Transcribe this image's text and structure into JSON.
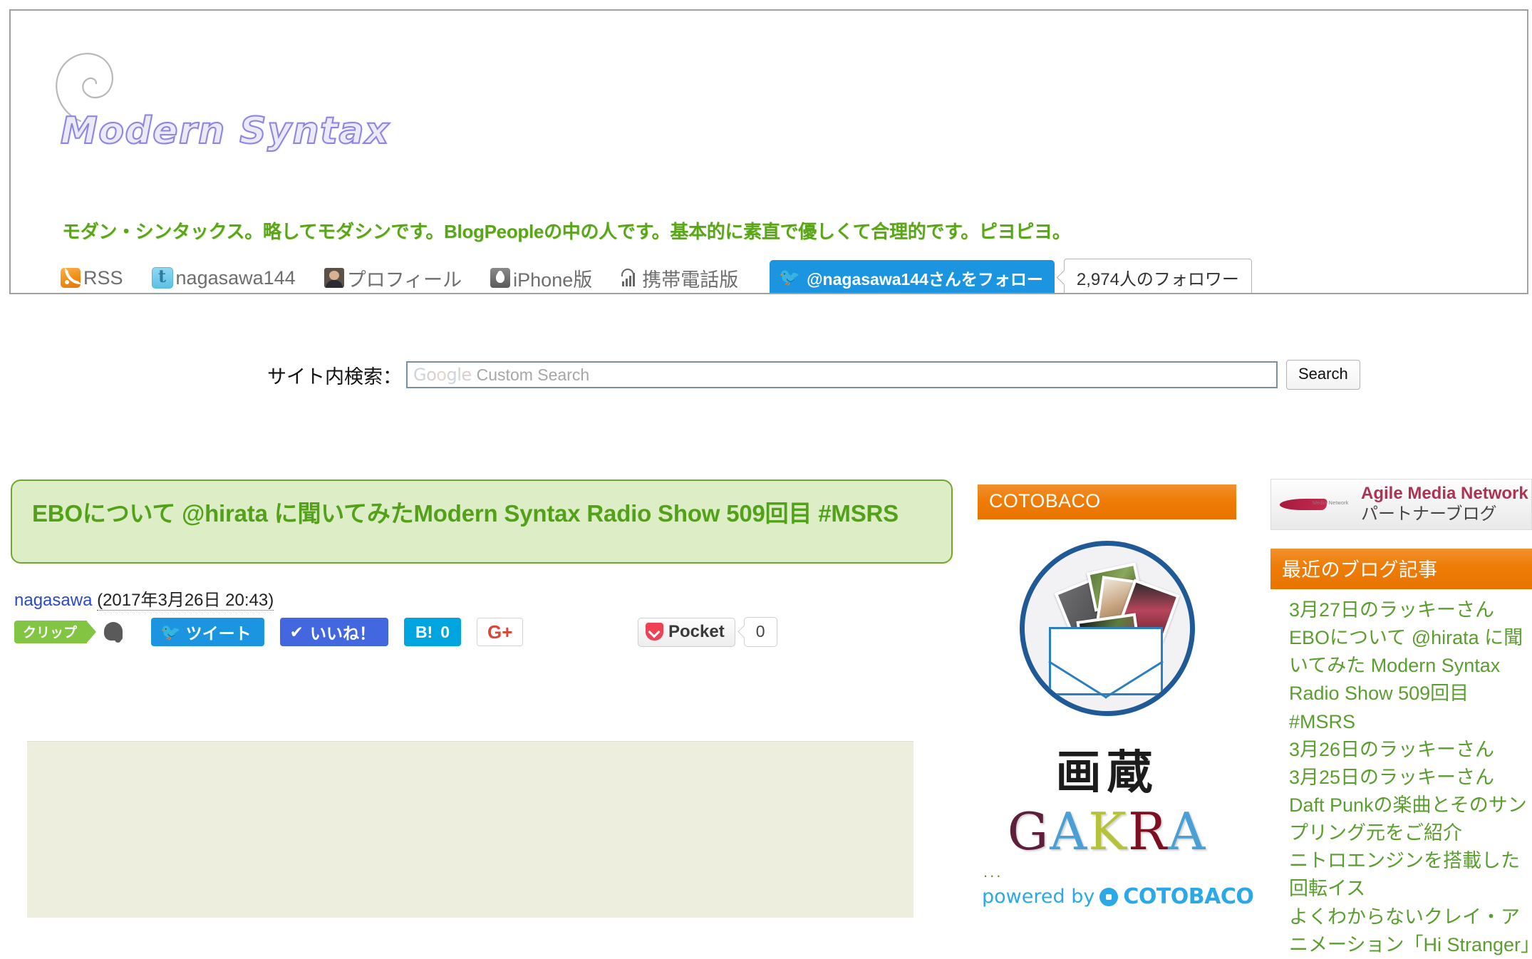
{
  "header": {
    "logo_text": "Modern Syntax",
    "logo_icon": "spiral-icon",
    "tagline": "モダン・シンタックス。略してモダシンです。BlogPeopleの中の人です。基本的に素直で優しくて合理的です。ピヨピヨ。",
    "nav": [
      {
        "label": "RSS",
        "icon": "rss-icon"
      },
      {
        "label": "nagasawa144",
        "icon": "twitter-icon"
      },
      {
        "label": "プロフィール",
        "icon": "profile-photo-icon"
      },
      {
        "label": "iPhone版",
        "icon": "apple-icon"
      },
      {
        "label": "携帯電話版",
        "icon": "mobile-signal-icon"
      }
    ],
    "follow_button": {
      "label": "@nagasawa144さんをフォロー",
      "icon": "twitter-bird-icon",
      "bg_color": "#1b95e0"
    },
    "follower_count": "2,974人のフォロワー"
  },
  "search": {
    "label": "サイト内検索：",
    "placeholder_brand": [
      "G",
      "o",
      "o",
      "g",
      "l",
      "e"
    ],
    "placeholder_text": "Custom Search",
    "value": "",
    "button_label": "Search"
  },
  "entry": {
    "title": "EBOについて @hirata に聞いてみたModern Syntax Radio Show 509回目 #MSRS",
    "author": "nagasawa",
    "date": "(2017年3月26日 20:43)",
    "title_bg": "#ddeec6",
    "title_border": "#6fa82a",
    "title_color": "#53a019",
    "share": {
      "evernote_label": "クリップ",
      "tweet_label": "ツイート",
      "like_label": "いいね！",
      "hatena_label": "B!",
      "hatena_count": "0",
      "gplus_label": "G+",
      "pocket_label": "Pocket",
      "pocket_count": "0"
    }
  },
  "cotobaco": {
    "header": "COTOBACO",
    "header_color": "#ee7c06",
    "kanji": "画蔵",
    "brand_letters": [
      "G",
      "A",
      "K",
      "R",
      "A"
    ],
    "dots": "...",
    "powered_by": "powered by",
    "powered_brand": "COTOBACO"
  },
  "amn_banner": {
    "line1": "Agile Media Network",
    "line2": "パートナーブログ",
    "logo_caption": "Media Network"
  },
  "recent_posts": {
    "header": "最近のブログ記事",
    "header_color": "#ee7c06",
    "items": [
      "3月27日のラッキーさん",
      "EBOについて @hirata に聞いてみた Modern Syntax Radio Show 509回目 #MSRS",
      "3月26日のラッキーさん",
      "3月25日のラッキーさん",
      "Daft Punkの楽曲とそのサンプリング元をご紹介",
      "ニトロエンジンを搭載した回転イス",
      "よくわからないクレイ・アニメーション「Hi Stranger」"
    ]
  }
}
